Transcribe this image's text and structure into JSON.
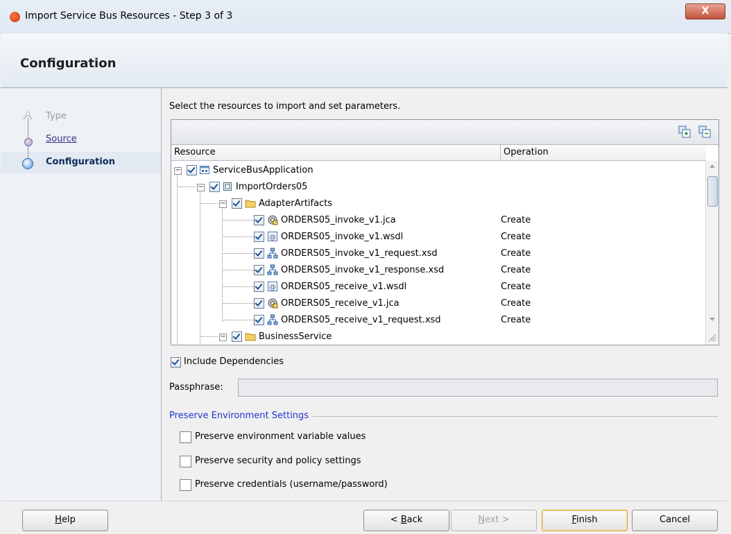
{
  "window": {
    "title": "Import Service Bus Resources - Step 3 of 3",
    "close_glyph": "X"
  },
  "header": {
    "title": "Configuration"
  },
  "train": {
    "steps": [
      {
        "label": "Type",
        "state": "disabled"
      },
      {
        "label": "Source",
        "state": "link"
      },
      {
        "label": "Configuration",
        "state": "current"
      }
    ]
  },
  "main": {
    "instruction": "Select the resources to import and set parameters.",
    "columns": {
      "resource": "Resource",
      "operation": "Operation"
    },
    "rows": [
      {
        "label": "ServiceBusApplication",
        "operation": "",
        "icon": "application-icon"
      },
      {
        "label": "ImportOrders05",
        "operation": "",
        "icon": "project-icon"
      },
      {
        "label": "AdapterArtifacts",
        "operation": "",
        "icon": "folder-icon"
      },
      {
        "label": "ORDERS05_invoke_v1.jca",
        "operation": "Create",
        "icon": "jca-icon"
      },
      {
        "label": "ORDERS05_invoke_v1.wsdl",
        "operation": "Create",
        "icon": "wsdl-icon"
      },
      {
        "label": "ORDERS05_invoke_v1_request.xsd",
        "operation": "Create",
        "icon": "xsd-icon"
      },
      {
        "label": "ORDERS05_invoke_v1_response.xsd",
        "operation": "Create",
        "icon": "xsd-icon"
      },
      {
        "label": "ORDERS05_receive_v1.wsdl",
        "operation": "Create",
        "icon": "wsdl-icon"
      },
      {
        "label": "ORDERS05_receive_v1.jca",
        "operation": "Create",
        "icon": "jca-icon"
      },
      {
        "label": "ORDERS05_receive_v1_request.xsd",
        "operation": "Create",
        "icon": "xsd-icon"
      },
      {
        "label": "BusinessService",
        "operation": "",
        "icon": "folder-icon"
      }
    ],
    "include_dependencies": {
      "label": "Include Dependencies",
      "checked": true
    },
    "passphrase": {
      "label": "Passphrase:",
      "value": ""
    },
    "preserve": {
      "title": "Preserve Environment Settings",
      "options": [
        {
          "label": "Preserve environment variable values",
          "checked": false
        },
        {
          "label": "Preserve security and policy settings",
          "checked": false
        },
        {
          "label": "Preserve credentials (username/password)",
          "checked": false
        }
      ]
    }
  },
  "buttons": {
    "help": {
      "prefix": "",
      "mnemonic": "H",
      "rest": "elp"
    },
    "back": {
      "prefix": "< ",
      "mnemonic": "B",
      "rest": "ack"
    },
    "next": {
      "prefix": "",
      "mnemonic": "N",
      "rest": "ext >"
    },
    "finish": {
      "prefix": "",
      "mnemonic": "F",
      "rest": "inish"
    },
    "cancel": {
      "label": "Cancel"
    }
  },
  "colors": {
    "section_title": "#1e36c8",
    "default_button_border": "#e0a33c",
    "current_step": "#0a2b59"
  }
}
